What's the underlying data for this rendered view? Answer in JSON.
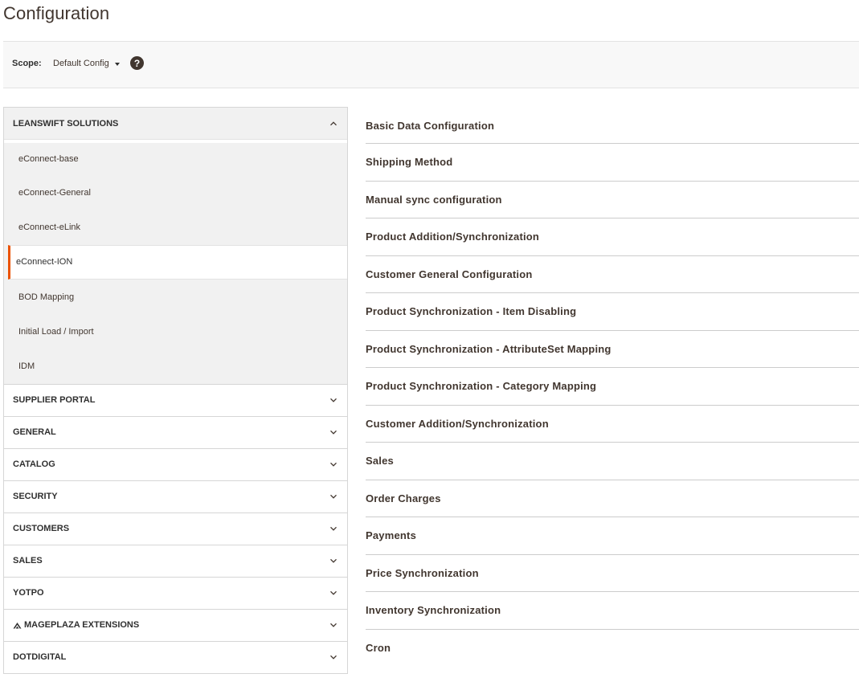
{
  "page": {
    "title": "Configuration"
  },
  "scope": {
    "label": "Scope:",
    "value": "Default Config",
    "help_icon": "question-circle-icon"
  },
  "sidebar": {
    "open_section": {
      "title": "LEANSWIFT SOLUTIONS",
      "items": [
        {
          "label": "eConnect-base"
        },
        {
          "label": "eConnect-General"
        },
        {
          "label": "eConnect-eLink"
        },
        {
          "label": "eConnect-ION",
          "active": true
        },
        {
          "label": "BOD Mapping"
        },
        {
          "label": "Initial Load / Import"
        },
        {
          "label": "IDM"
        }
      ]
    },
    "sections": [
      {
        "title": "SUPPLIER PORTAL"
      },
      {
        "title": "GENERAL"
      },
      {
        "title": "CATALOG"
      },
      {
        "title": "SECURITY"
      },
      {
        "title": "CUSTOMERS"
      },
      {
        "title": "SALES"
      },
      {
        "title": "YOTPO"
      },
      {
        "title": "MAGEPLAZA EXTENSIONS",
        "icon": "mageplaza-logo-icon"
      },
      {
        "title": "DOTDIGITAL"
      }
    ]
  },
  "main": {
    "groups": [
      {
        "label": "Basic Data Configuration"
      },
      {
        "label": "Shipping Method"
      },
      {
        "label": "Manual sync configuration"
      },
      {
        "label": "Product Addition/Synchronization"
      },
      {
        "label": "Customer General Configuration"
      },
      {
        "label": "Product Synchronization - Item Disabling"
      },
      {
        "label": "Product Synchronization - AttributeSet Mapping"
      },
      {
        "label": "Product Synchronization - Category Mapping"
      },
      {
        "label": "Customer Addition/Synchronization"
      },
      {
        "label": "Sales"
      },
      {
        "label": "Order Charges"
      },
      {
        "label": "Payments"
      },
      {
        "label": "Price Synchronization"
      },
      {
        "label": "Inventory Synchronization"
      },
      {
        "label": "Cron"
      }
    ]
  },
  "colors": {
    "accent": "#eb5202",
    "text": "#41362f",
    "panel": "#f1f1f1"
  }
}
